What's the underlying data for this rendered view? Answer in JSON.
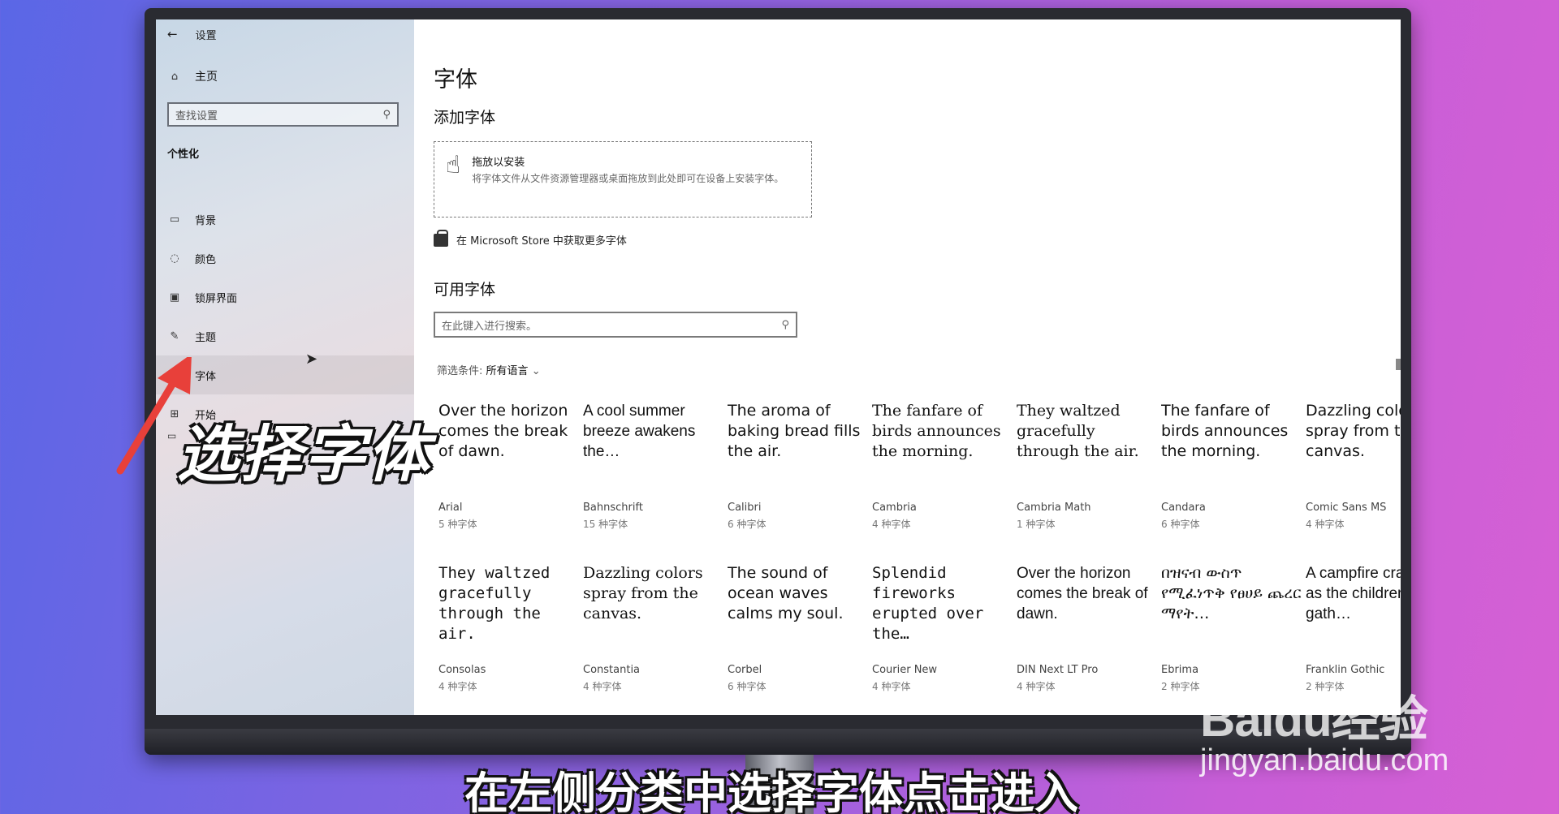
{
  "window": {
    "title": "设置",
    "back_icon": "back-arrow-icon"
  },
  "sidebar": {
    "home_label": "主页",
    "search_placeholder": "查找设置",
    "section_title": "个性化",
    "items": [
      {
        "label": "背景",
        "icon": "picture-icon"
      },
      {
        "label": "颜色",
        "icon": "palette-icon"
      },
      {
        "label": "锁屏界面",
        "icon": "lockscreen-icon"
      },
      {
        "label": "主题",
        "icon": "theme-icon"
      },
      {
        "label": "字体",
        "icon": "font-icon",
        "active": true
      },
      {
        "label": "开始",
        "icon": "start-icon"
      }
    ]
  },
  "main": {
    "title": "字体",
    "add_heading": "添加字体",
    "dropzone_title": "拖放以安装",
    "dropzone_desc": "将字体文件从文件资源管理器或桌面拖放到此处即可在设备上安装字体。",
    "store_link": "在 Microsoft Store 中获取更多字体",
    "available_heading": "可用字体",
    "search_placeholder": "在此键入进行搜索。",
    "filter_label": "筛选条件:",
    "filter_value": "所有语言"
  },
  "fonts": [
    {
      "sample": "Over the horizon comes the break of dawn.",
      "name": "Arial",
      "count": "5 种字体",
      "style": ""
    },
    {
      "sample": "A cool summer breeze awakens the…",
      "name": "Bahnschrift",
      "count": "15 种字体",
      "style": "cond"
    },
    {
      "sample": "The aroma of baking bread fills the air.",
      "name": "Calibri",
      "count": "6 种字体",
      "style": ""
    },
    {
      "sample": "The fanfare of birds announces the morning.",
      "name": "Cambria",
      "count": "4 种字体",
      "style": "serif"
    },
    {
      "sample": "They waltzed gracefully through the air.",
      "name": "Cambria Math",
      "count": "1 种字体",
      "style": "serif"
    },
    {
      "sample": "The fanfare of birds announces the morning.",
      "name": "Candara",
      "count": "6 种字体",
      "style": ""
    },
    {
      "sample": "Dazzling colors spray from the canvas.",
      "name": "Comic Sans MS",
      "count": "4 种字体",
      "style": ""
    },
    {
      "sample": "They waltzed gracefully through the air.",
      "name": "Consolas",
      "count": "4 种字体",
      "style": "mono"
    },
    {
      "sample": "Dazzling colors spray from the canvas.",
      "name": "Constantia",
      "count": "4 种字体",
      "style": "serif"
    },
    {
      "sample": "The sound of ocean waves calms my soul.",
      "name": "Corbel",
      "count": "6 种字体",
      "style": ""
    },
    {
      "sample": "Splendid fireworks erupted over the…",
      "name": "Courier New",
      "count": "4 种字体",
      "style": "mono"
    },
    {
      "sample": "Over the horizon comes the break of dawn.",
      "name": "DIN Next LT Pro",
      "count": "4 种字体",
      "style": "cond"
    },
    {
      "sample": "በዝናብ ውስጥ የሚፈነጥቅ የፀሀይ ጨረር ማየት…",
      "name": "Ebrima",
      "count": "2 种字体",
      "style": ""
    },
    {
      "sample": "A campfire crackles as the children gath…",
      "name": "Franklin Gothic",
      "count": "2 种字体",
      "style": "cond"
    }
  ],
  "overlay": {
    "annotation": "选择字体",
    "subtitle": "在左侧分类中选择字体点击进入",
    "watermark_logo": "Baidu经验",
    "watermark_url": "jingyan.baidu.com",
    "arrow_color": "#e8403a"
  }
}
